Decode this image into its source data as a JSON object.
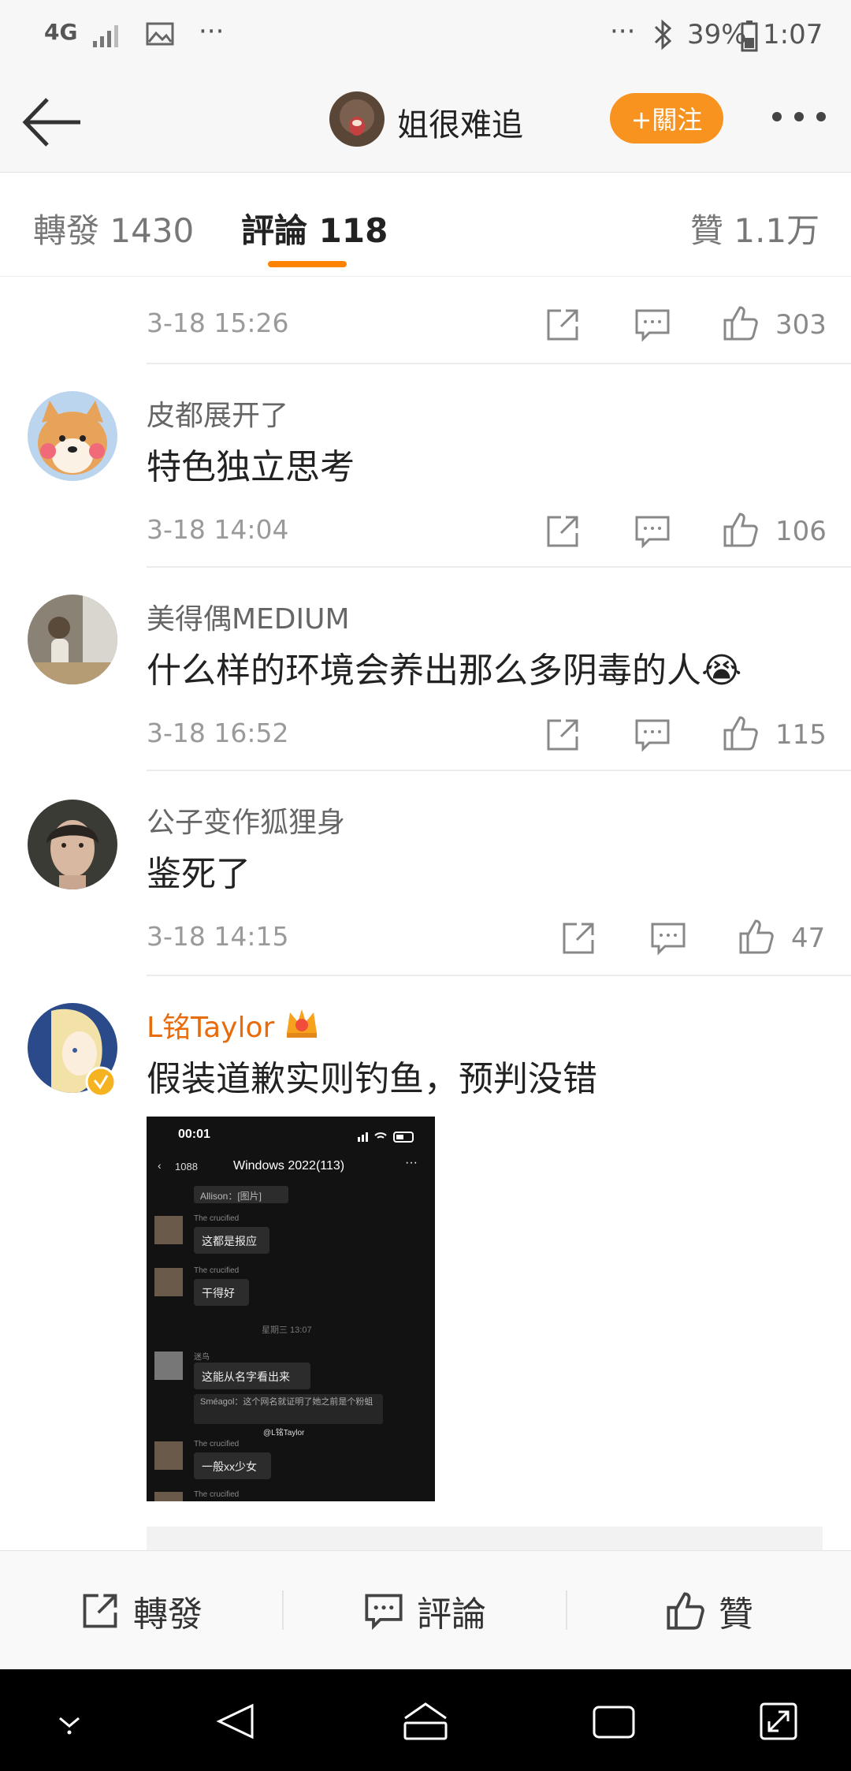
{
  "status_bar": {
    "network": "4G",
    "dots_left": "···",
    "dots_right": "···",
    "battery": "39%",
    "time": "1:07"
  },
  "header": {
    "username": "姐很难追",
    "follow_label": "+關注"
  },
  "tabs": [
    {
      "label": "轉發 1430"
    },
    {
      "label": "評論 118"
    },
    {
      "label": "贊 1.1万"
    }
  ],
  "first_item": {
    "time": "3-18 15:26",
    "likes": "303"
  },
  "comments": [
    {
      "user": "皮都展开了",
      "text": "特色独立思考",
      "time": "3-18 14:04",
      "likes": "106"
    },
    {
      "user": "美得偶MEDIUM",
      "text": "什么样的环境会养出那么多阴毒的人😭",
      "time": "3-18 16:52",
      "likes": "115"
    },
    {
      "user": "公子变作狐狸身",
      "text": "鉴死了",
      "time": "3-18 14:15",
      "likes": "47"
    },
    {
      "user": "L铭Taylor",
      "text": "假装道歉实则钓鱼，预判没错"
    }
  ],
  "screenshot": {
    "time": "00:01",
    "back_count": "1088",
    "chat_title": "Windows 2022(113)",
    "dots": "···",
    "messages": [
      {
        "sender": "",
        "text": "Allison：[图片]"
      },
      {
        "sender": "The crucified",
        "text": "这都是报应"
      },
      {
        "sender": "The crucified",
        "text": "干得好"
      },
      {
        "sender": "",
        "text": "星期三 13:07"
      },
      {
        "sender": "迷鸟",
        "text": "这能从名字看出来"
      },
      {
        "sender": "",
        "text": "Sméagol：这个网名就证明了她之前是个粉蛆"
      },
      {
        "sender": "The crucified",
        "text": "一般xx少女"
      },
      {
        "sender": "The crucified",
        "text": ""
      }
    ],
    "watermark": "@L铭Taylor"
  },
  "bottom_bar": {
    "repost": "轉發",
    "comment": "評論",
    "like": "贊"
  },
  "colors": {
    "accent": "#ff8200",
    "follow_button": "#f7931e",
    "vip_name": "#e86b0c"
  }
}
